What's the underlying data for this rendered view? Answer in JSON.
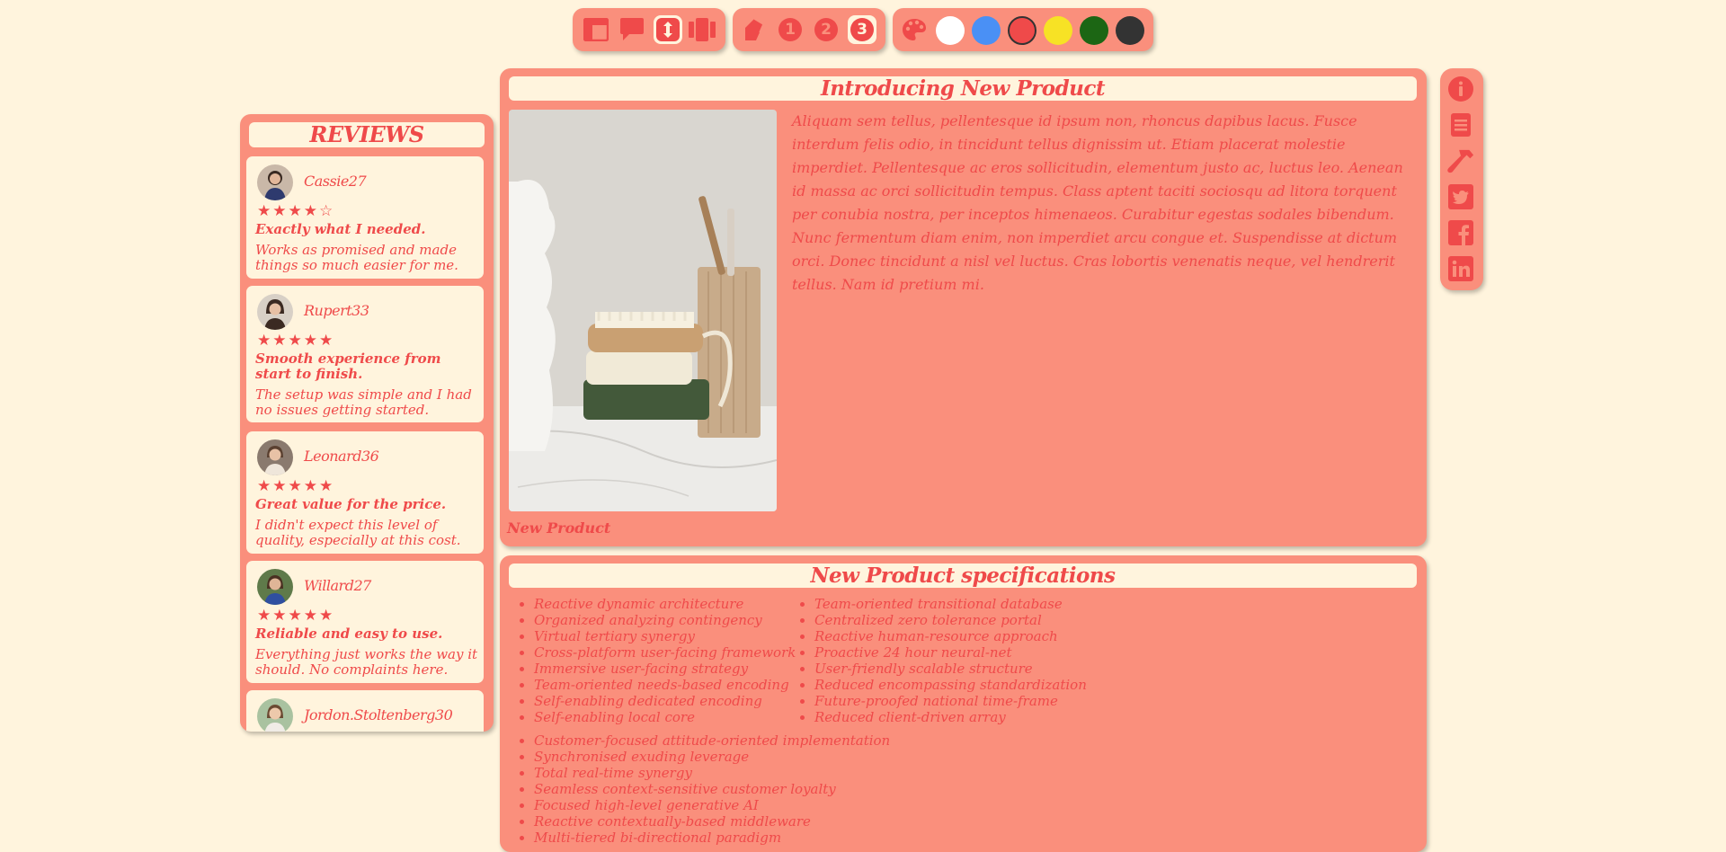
{
  "toolbar": {
    "layout_group": [
      "layout-icon",
      "comment-icon",
      "vertical-resize-icon",
      "columns-icon"
    ],
    "page_group": {
      "icon": "pages-icon",
      "numbers": [
        "1",
        "2",
        "3"
      ],
      "active": "3"
    },
    "color_group": {
      "icon": "palette-icon",
      "swatches": [
        "#ffffff",
        "#4a90f5",
        "#ef4a4a",
        "#f7e225",
        "#1c6614",
        "#333333"
      ]
    }
  },
  "reviews": {
    "heading": "REVIEWS",
    "items": [
      {
        "name": "Cassie27",
        "rating": 4,
        "stars": "★★★★☆",
        "title": "Exactly what I needed.",
        "body": "Works as promised and made things so much easier for me."
      },
      {
        "name": "Rupert33",
        "rating": 5,
        "stars": "★★★★★",
        "title": "Smooth experience from start to finish.",
        "body": "The setup was simple and I had no issues getting started."
      },
      {
        "name": "Leonard36",
        "rating": 5,
        "stars": "★★★★★",
        "title": "Great value for the price.",
        "body": "I didn't expect this level of quality, especially at this cost."
      },
      {
        "name": "Willard27",
        "rating": 5,
        "stars": "★★★★★",
        "title": "Reliable and easy to use.",
        "body": "Everything just works the way it should. No complaints here."
      },
      {
        "name": "Jordon.Stoltenberg30",
        "rating": null,
        "stars": "",
        "title": "",
        "body": ""
      }
    ]
  },
  "product": {
    "title": "Introducing New Product",
    "description": "Aliquam sem tellus, pellentesque id ipsum non, rhoncus dapibus lacus. Fusce interdum felis odio, in tincidunt tellus dignissim ut. Etiam placerat molestie imperdiet. Pellentesque ac eros sollicitudin, elementum justo ac, luctus leo. Aenean id massa ac orci sollicitudin tempus. Class aptent taciti sociosqu ad litora torquent per conubia nostra, per inceptos himenaeos. Curabitur egestas sodales bibendum. Nunc fermentum diam enim, non imperdiet arcu congue et. Suspendisse at dictum orci. Donec tincidunt a nisl vel luctus. Cras lobortis venenatis neque, vel hendrerit tellus. Nam id pretium mi.",
    "caption": "New Product"
  },
  "specs": {
    "title": "New Product specifications",
    "col1": [
      "Reactive dynamic architecture",
      "Organized analyzing contingency",
      "Virtual tertiary synergy",
      "Cross-platform user-facing framework",
      "Immersive user-facing strategy",
      "Team-oriented needs-based encoding",
      "Self-enabling dedicated encoding",
      "Self-enabling local core"
    ],
    "col2": [
      "Team-oriented transitional database",
      "Centralized zero tolerance portal",
      "Reactive human-resource approach",
      "Proactive 24 hour neural-net",
      "User-friendly scalable structure",
      "Reduced encompassing standardization",
      "Future-proofed national time-frame",
      "Reduced client-driven array"
    ],
    "col3": [
      "Customer-focused attitude-oriented implementation",
      "Synchronised exuding leverage",
      "Total real-time synergy",
      "Seamless context-sensitive customer loyalty",
      "Focused high-level generative AI",
      "Reactive contextually-based middleware",
      "Multi-tiered bi-directional paradigm"
    ]
  },
  "sidebar": {
    "icons": [
      "info-icon",
      "document-icon",
      "hammer-icon",
      "twitter-icon",
      "facebook-icon",
      "linkedin-icon"
    ]
  },
  "colors": {
    "background": "#fff4dd",
    "panel": "#fa8f7c",
    "accent": "#ef4a4a"
  }
}
